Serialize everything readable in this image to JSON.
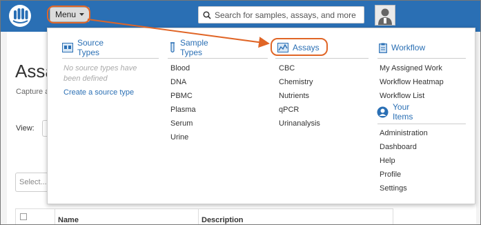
{
  "header": {
    "menu_label": "Menu",
    "search_placeholder": "Search for samples, assays, and more"
  },
  "page": {
    "title": "Assa",
    "subtitle": "Capture a",
    "view_label": "View:",
    "select_placeholder": "Select...",
    "columns": [
      "Name",
      "Description"
    ]
  },
  "menu": {
    "source_types": {
      "title": "Source Types",
      "empty_message": "No source types have been defined",
      "create_link": "Create a source type"
    },
    "sample_types": {
      "title": "Sample Types",
      "items": [
        "Blood",
        "DNA",
        "PBMC",
        "Plasma",
        "Serum",
        "Urine"
      ]
    },
    "assays": {
      "title": "Assays",
      "items": [
        "CBC",
        "Chemistry",
        "Nutrients",
        "qPCR",
        "Urinanalysis"
      ]
    },
    "workflow": {
      "title": "Workflow",
      "items": [
        "My Assigned Work",
        "Workflow Heatmap",
        "Workflow List"
      ]
    },
    "your_items": {
      "title": "Your Items",
      "items": [
        "Administration",
        "Dashboard",
        "Help",
        "Profile",
        "Settings"
      ]
    }
  },
  "colors": {
    "header_bg": "#2a6fb4",
    "link": "#2a6fb4",
    "callout": "#e06526"
  }
}
